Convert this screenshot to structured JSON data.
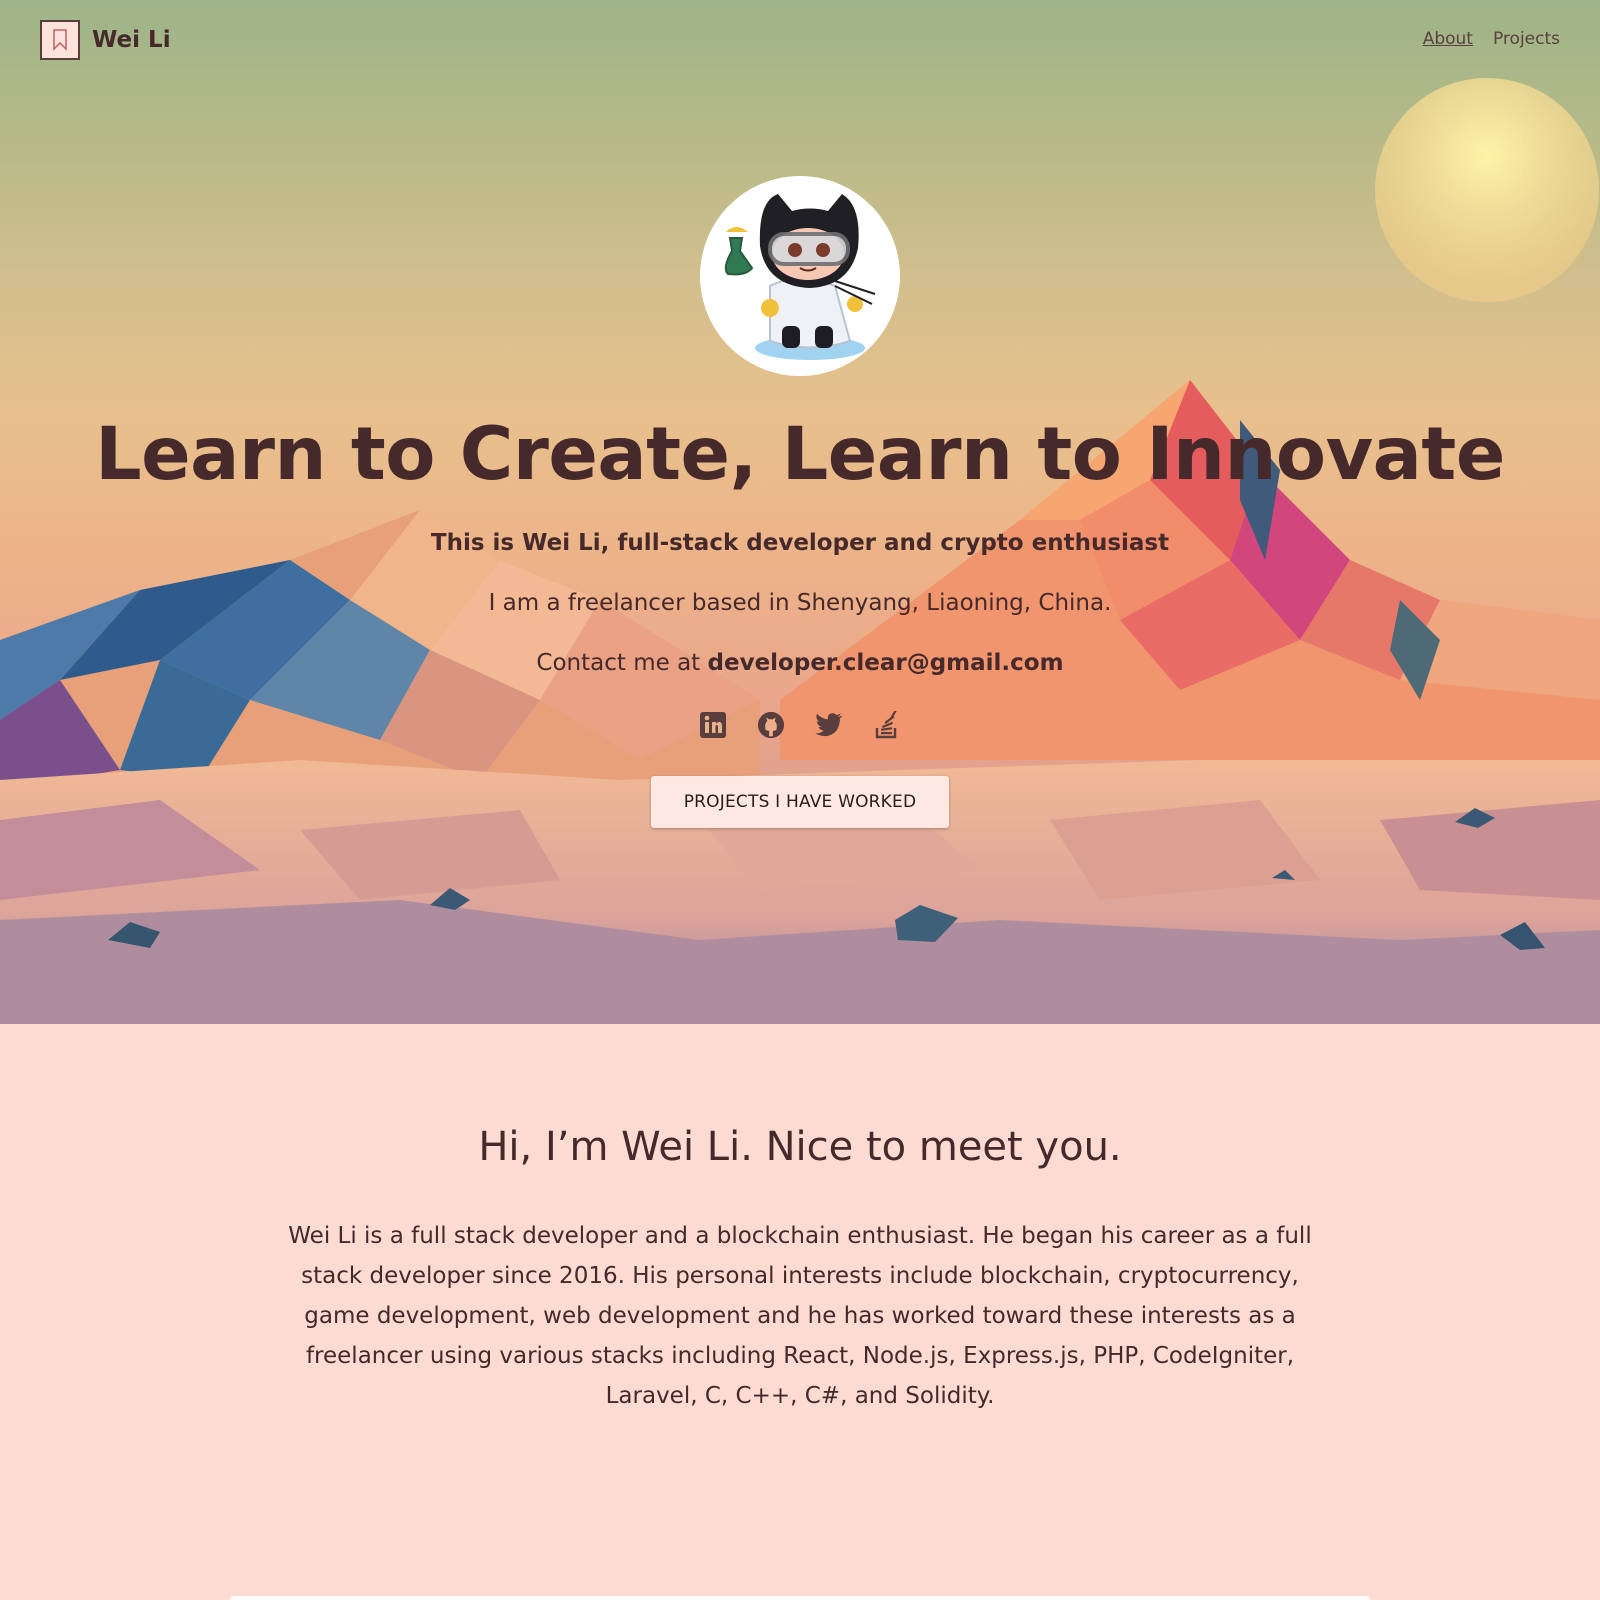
{
  "nav": {
    "brand_name": "Wei Li",
    "links": [
      {
        "label": "About",
        "active": true
      },
      {
        "label": "Projects",
        "active": false
      }
    ]
  },
  "hero": {
    "title": "Learn to Create, Learn to Innovate",
    "subtitle": "This is Wei Li, full-stack developer and crypto enthusiast",
    "location": "I am a freelancer based in Shenyang, Liaoning, China.",
    "contact_prefix": "Contact me at ",
    "contact_email": "developer.clear@gmail.com",
    "socials": [
      "linkedin-icon",
      "github-icon",
      "twitter-icon",
      "stackoverflow-icon"
    ],
    "cta_label": "PROJECTS I HAVE WORKED"
  },
  "about": {
    "title": "Hi, I’m Wei Li. Nice to meet you.",
    "body": "Wei Li is a full stack developer and a blockchain enthusiast. He began his career as a full stack developer since 2016. His personal interests include blockchain, cryptocurrency, game development, web development and he has worked toward these interests as a freelancer using various stacks including React, Node.js, Express.js, PHP, CodeIgniter, Laravel, C, C++, C#, and Solidity."
  },
  "colors": {
    "text": "#45292b",
    "background": "#fcdbd2",
    "button": "#fde8e4",
    "sky_top": "#9db488",
    "sun": "#fdeea4"
  }
}
